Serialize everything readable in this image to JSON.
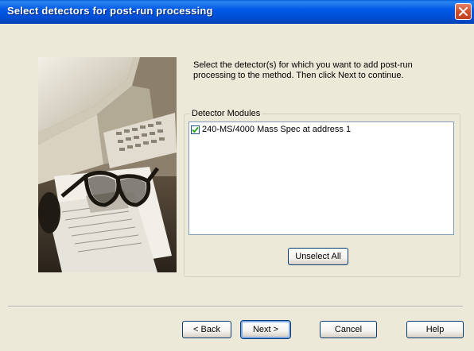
{
  "window": {
    "title": "Select detectors for post-run processing"
  },
  "instructions": {
    "line1": "Select the detector(s) for which you want to add post-run",
    "line2": "processing to the method. Then click Next to continue."
  },
  "detector_modules": {
    "label": "Detector Modules",
    "items": [
      {
        "label": "240-MS/4000 Mass Spec at address 1",
        "checked": true
      }
    ],
    "unselect_label": "Unselect All"
  },
  "footer": {
    "back_label": "< Back",
    "next_label": "Next >",
    "cancel_label": "Cancel",
    "help_label": "Help"
  },
  "colors": {
    "titlebar": "#0058e6",
    "dialog_bg": "#ece9d8",
    "close_button": "#d2522d",
    "button_border": "#003c74"
  },
  "icons": {
    "close": "close-icon",
    "check": "checkmark-icon"
  }
}
